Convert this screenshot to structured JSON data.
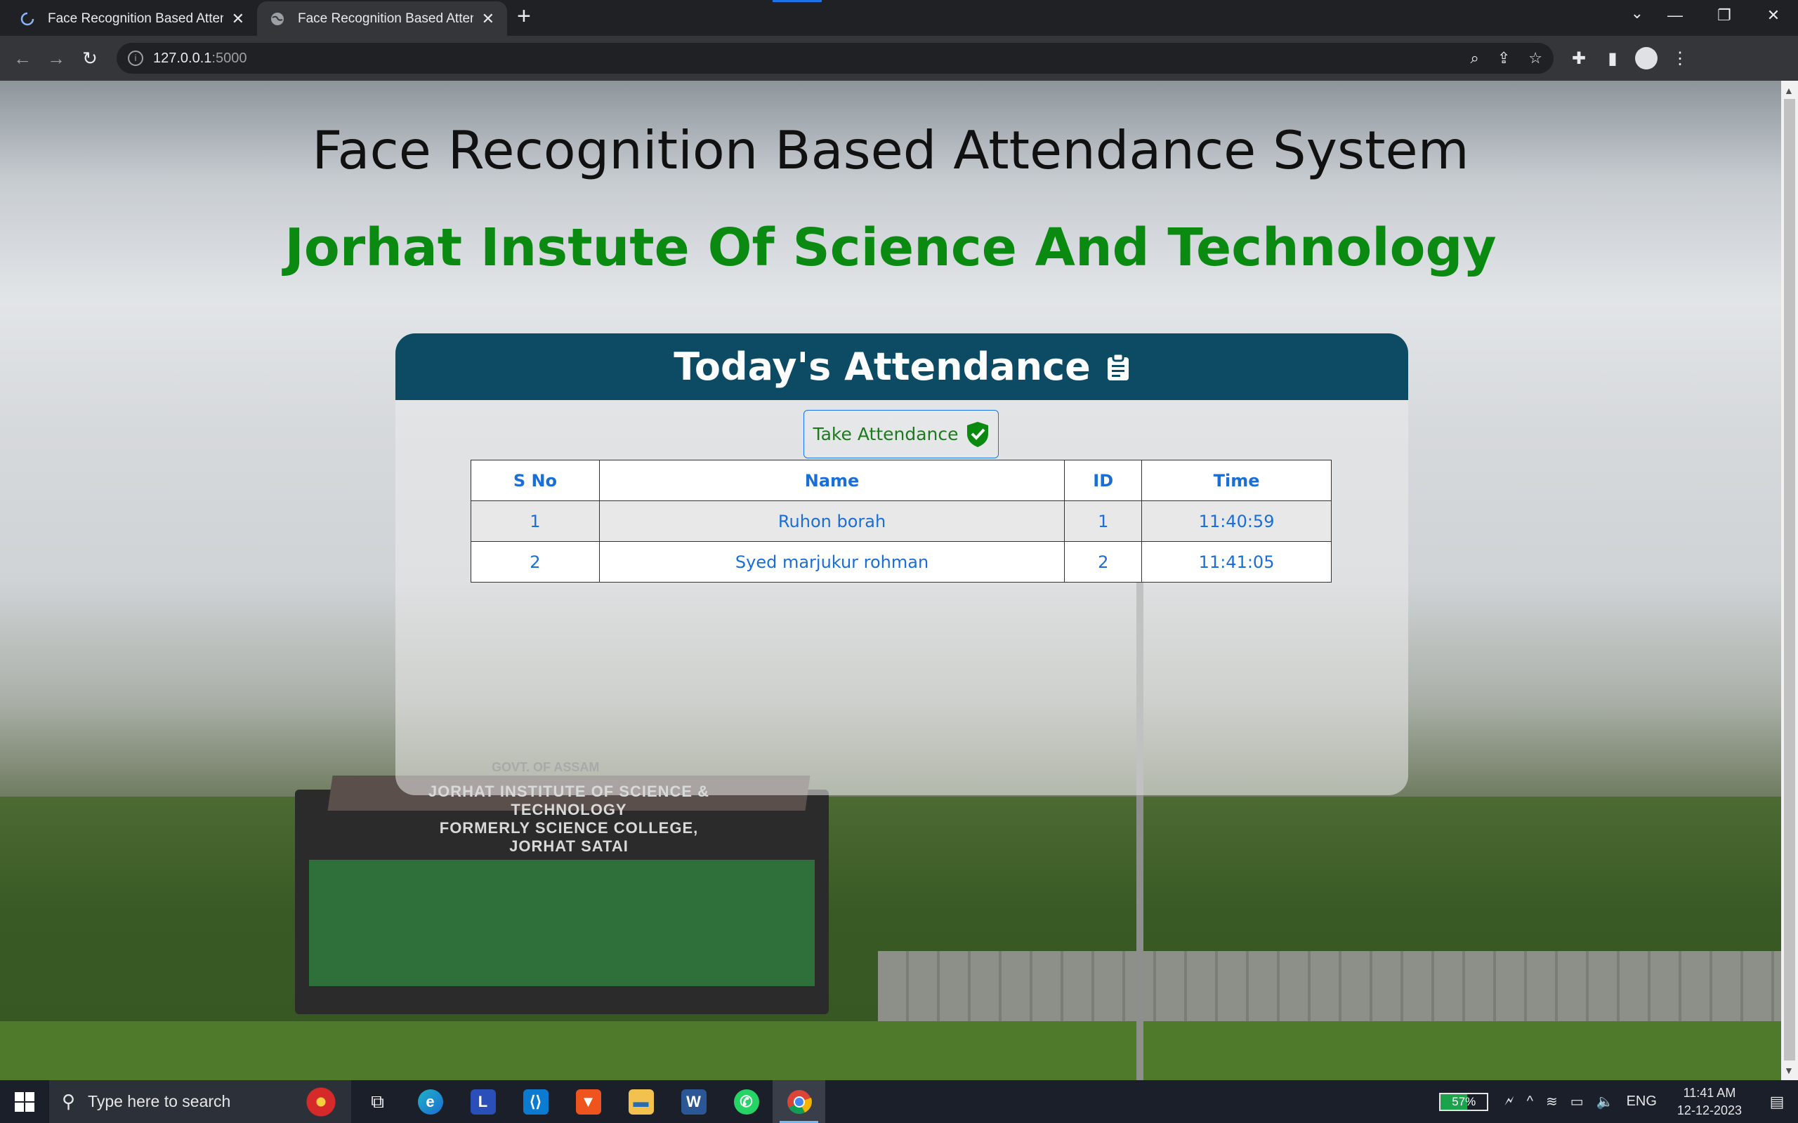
{
  "browser": {
    "tabs": [
      {
        "title": "Face Recognition Based Attendance",
        "active": false
      },
      {
        "title": "Face Recognition Based Attendance",
        "active": true
      }
    ],
    "url_host": "127.0.0.1",
    "url_port": ":5000"
  },
  "page": {
    "title": "Face Recognition Based Attendance System",
    "institute": "Jorhat Instute Of Science And Technology",
    "card_title": "Today's Attendance",
    "take_attendance_label": "Take Attendance",
    "table": {
      "headers": [
        "S No",
        "Name",
        "ID",
        "Time"
      ],
      "rows": [
        [
          "1",
          "Ruhon borah",
          "1",
          "11:40:59"
        ],
        [
          "2",
          "Syed marjukur rohman",
          "2",
          "11:41:05"
        ]
      ]
    },
    "background_sign": {
      "top": "GOVT. OF ASSAM",
      "line1": "JORHAT INSTITUTE OF SCIENCE & TECHNOLOGY",
      "line2": "FORMERLY SCIENCE COLLEGE, JORHAT SATAI"
    }
  },
  "taskbar": {
    "search_placeholder": "Type here to search",
    "battery": "57%",
    "language": "ENG",
    "time": "11:41 AM",
    "date": "12-12-2023",
    "apps": [
      "task-view",
      "edge",
      "l-app",
      "vscode",
      "brave",
      "file-explorer",
      "word",
      "whatsapp",
      "chrome"
    ]
  },
  "colors": {
    "header_bg": "#0d4a63",
    "institute_green": "#0b8a12",
    "table_text": "#1a6ed8"
  }
}
